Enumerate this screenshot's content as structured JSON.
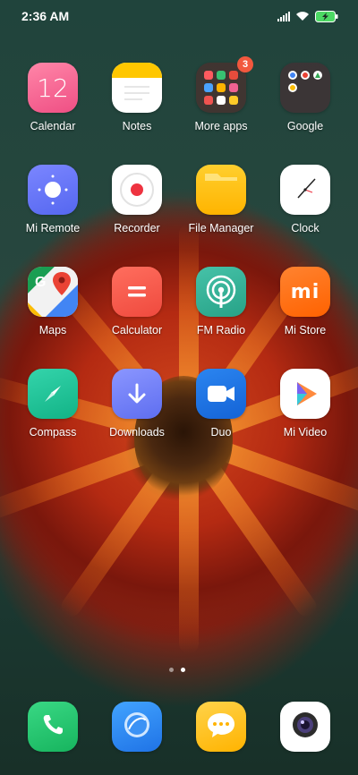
{
  "status_bar": {
    "time": "2:36 AM"
  },
  "apps": {
    "row1": [
      {
        "label": "Calendar",
        "icon": "calendar-icon",
        "value": "12"
      },
      {
        "label": "Notes",
        "icon": "notes-icon"
      },
      {
        "label": "More apps",
        "icon": "folder-icon",
        "badge": "3"
      },
      {
        "label": "Google",
        "icon": "folder-icon"
      }
    ],
    "row2": [
      {
        "label": "Mi Remote",
        "icon": "remote-icon"
      },
      {
        "label": "Recorder",
        "icon": "record-icon"
      },
      {
        "label": "File Manager",
        "icon": "folder-icon"
      },
      {
        "label": "Clock",
        "icon": "clock-icon"
      }
    ],
    "row3": [
      {
        "label": "Maps",
        "icon": "map-pin-icon"
      },
      {
        "label": "Calculator",
        "icon": "equals-icon"
      },
      {
        "label": "FM Radio",
        "icon": "radio-icon"
      },
      {
        "label": "Mi Store",
        "icon": "mi-logo-icon",
        "logo_text": "mi"
      }
    ],
    "row4": [
      {
        "label": "Compass",
        "icon": "compass-icon"
      },
      {
        "label": "Downloads",
        "icon": "download-arrow-icon"
      },
      {
        "label": "Duo",
        "icon": "video-camera-icon"
      },
      {
        "label": "Mi Video",
        "icon": "play-icon"
      }
    ]
  },
  "dock": [
    {
      "name": "phone",
      "icon": "phone-icon"
    },
    {
      "name": "browser",
      "icon": "browser-icon"
    },
    {
      "name": "messages",
      "icon": "chat-bubble-icon"
    },
    {
      "name": "camera",
      "icon": "camera-icon"
    }
  ],
  "page_indicator": {
    "pages": 2,
    "current": 2
  },
  "colors": {
    "calendar": "#f4608e",
    "notes": "#ffffff",
    "notes_accent": "#ffc700",
    "recorder_red": "#ee3340",
    "file_manager": "#ffbd14",
    "calculator": "#f2564a",
    "fm_radio": "#35b49a",
    "mi_store": "#ff6a00",
    "compass": "#22c29a",
    "downloads": "#6b7df3",
    "duo": "#1a73e8",
    "phone": "#22c46a",
    "browser": "#2f8cf0",
    "messages": "#ffbf1a",
    "badge": "#f2583e"
  }
}
